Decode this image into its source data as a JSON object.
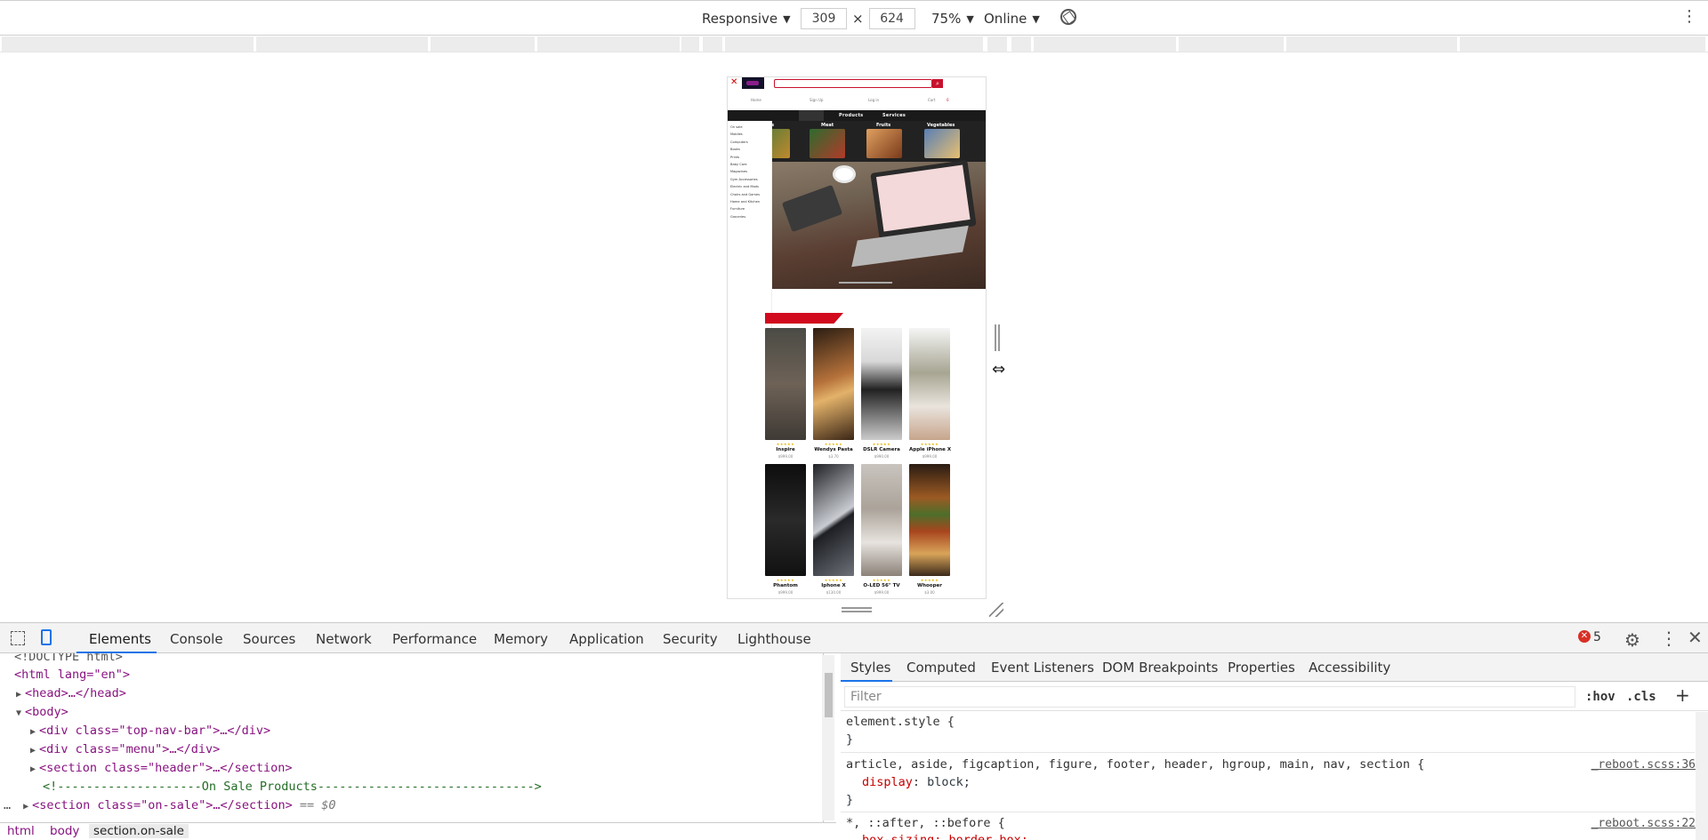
{
  "device_toolbar": {
    "mode": "Responsive",
    "width": "309",
    "height": "624",
    "times": "×",
    "zoom": "75%",
    "throttle": "Online"
  },
  "emulated_page": {
    "top_links": [
      "Home",
      "Sign Up",
      "Log in",
      "Cart",
      "0"
    ],
    "category_bar": [
      "Products",
      "Services"
    ],
    "thumb_labels": [
      "ies",
      "Meat",
      "Fruits",
      "Vegetables"
    ],
    "side_menu": [
      "On sale",
      "Mobiles",
      "Computers",
      "Books",
      "Prints",
      "Baby Care",
      "Magazines",
      "Gym Accessories",
      "Electric and Mads",
      "Chairs and Games",
      "Home and Kitchen",
      "Furniture",
      "Groceries"
    ],
    "products": [
      {
        "name": "Inspire",
        "price": "$999.00",
        "stars": "★★★★★"
      },
      {
        "name": "Wendys Pasta",
        "price": "$3.70",
        "stars": "★★★★★"
      },
      {
        "name": "DSLR Camera",
        "price": "$990.00",
        "stars": "★★★★★"
      },
      {
        "name": "Apple iPhone X",
        "price": "$999.00",
        "stars": "★★★★★"
      },
      {
        "name": "Phantom",
        "price": "$999.00",
        "stars": "★★★★★"
      },
      {
        "name": "Iphone X",
        "price": "$130.00",
        "stars": "★★★★★"
      },
      {
        "name": "O-LED 56\" TV",
        "price": "$999.00",
        "stars": "★★★★★"
      },
      {
        "name": "Whooper",
        "price": "$3.00",
        "stars": "★★★★★"
      }
    ],
    "colors": {
      "accent": "#c8102e",
      "banner": "#d10a1d",
      "dark_bar": "#1a1a1a"
    }
  },
  "devtools": {
    "tabs": [
      "Elements",
      "Console",
      "Sources",
      "Network",
      "Performance",
      "Memory",
      "Application",
      "Security",
      "Lighthouse"
    ],
    "active_tab": "Elements",
    "error_count": "5",
    "dom_lines": {
      "doctype": "<!DOCTYPE html>",
      "html_open": "<html lang=\"en\">",
      "head": "<head>…</head>",
      "body": "<body>",
      "topnav": "<div class=\"top-nav-bar\">…</div>",
      "menu": "<div class=\"menu\">…</div>",
      "header": "<section class=\"header\">…</section>",
      "comment": "<!--------------------On Sale Products------------------------------>",
      "onsale": "<section class=\"on-sale\">…</section>",
      "onsale_suffix": "== $0",
      "ellipsis": "…"
    },
    "breadcrumb": [
      "html",
      "body",
      "section.on-sale"
    ],
    "styles_tabs": [
      "Styles",
      "Computed",
      "Event Listeners",
      "DOM Breakpoints",
      "Properties",
      "Accessibility"
    ],
    "filter_placeholder": "Filter",
    "hov": ":hov",
    "cls": ".cls",
    "plus": "+",
    "rules": {
      "element_style": "element.style {",
      "close": "}",
      "r1_selector": "article, aside, figcaption, figure, footer, header, hgroup, main, nav, section {",
      "r1_prop": "display",
      "r1_value": ": block;",
      "r1_source": "_reboot.scss:36",
      "r2_selector": "*, ::after, ::before {",
      "r2_source": "_reboot.scss:22",
      "r2_prop": "box-sizing: border-box;"
    }
  }
}
